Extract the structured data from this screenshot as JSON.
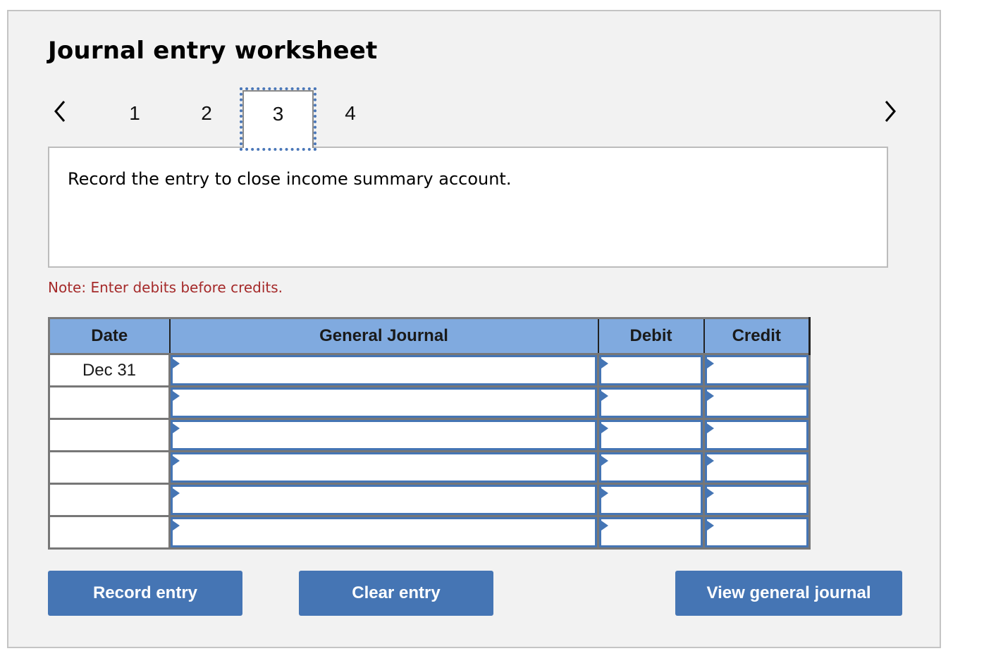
{
  "worksheet": {
    "title": "Journal entry worksheet",
    "nav": {
      "prev_icon": "chevron-left-icon",
      "next_icon": "chevron-right-icon",
      "tabs": [
        {
          "label": "1",
          "active": false
        },
        {
          "label": "2",
          "active": false
        },
        {
          "label": "3",
          "active": true
        },
        {
          "label": "4",
          "active": false
        }
      ]
    },
    "prompt": "Record the entry to close income summary account.",
    "note": "Note: Enter debits before credits."
  },
  "journal_table": {
    "headers": {
      "date": "Date",
      "general_journal": "General Journal",
      "debit": "Debit",
      "credit": "Credit"
    },
    "rows": [
      {
        "date": "Dec 31",
        "account": "",
        "debit": "",
        "credit": ""
      },
      {
        "date": "",
        "account": "",
        "debit": "",
        "credit": ""
      },
      {
        "date": "",
        "account": "",
        "debit": "",
        "credit": ""
      },
      {
        "date": "",
        "account": "",
        "debit": "",
        "credit": ""
      },
      {
        "date": "",
        "account": "",
        "debit": "",
        "credit": ""
      },
      {
        "date": "",
        "account": "",
        "debit": "",
        "credit": ""
      }
    ]
  },
  "buttons": {
    "record": "Record entry",
    "clear": "Clear entry",
    "view": "View general journal"
  },
  "colors": {
    "panel_bg": "#f2f2f2",
    "header_bg": "#80aadf",
    "button_bg": "#4575b4",
    "note_text": "#a52a2a",
    "focus_outline": "#4a77b8"
  }
}
